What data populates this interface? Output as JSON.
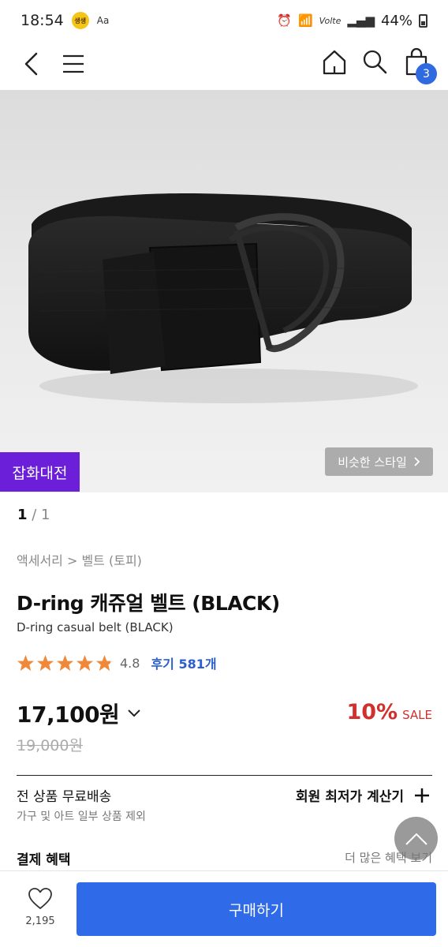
{
  "status_bar": {
    "time": "18:54",
    "emoji_text": "생생",
    "aa_text": "Aa",
    "wifi_text": "Volte",
    "battery": "44%"
  },
  "header": {
    "cart_count": "3"
  },
  "hero": {
    "promo_tag": "잡화대전",
    "similar_style": "비슷한 스타일"
  },
  "pager": {
    "current": "1",
    "total": "/ 1"
  },
  "product": {
    "breadcrumb": "액세서리 > 벨트 (토피)",
    "title": "D-ring 캐쥬얼 벨트 (BLACK)",
    "subtitle": "D-ring casual belt (BLACK)",
    "rating": 4.8,
    "rating_text": "4.8",
    "review_link": "후기 581개",
    "price": "17,100원",
    "original_price": "19,000원",
    "discount_pct": "10%",
    "discount_label": "SALE"
  },
  "shipping": {
    "title": "전 상품 무료배송",
    "note": "가구 및 아트 일부 상품 제외",
    "member_calc": "회원 최저가 계산기"
  },
  "payment": {
    "title": "결제 혜택",
    "more": "더 많은 혜택 보기"
  },
  "bottom": {
    "like_count": "2,195",
    "buy_label": "구매하기"
  },
  "colors": {
    "accent": "#2f6ae8",
    "promo": "#6b1fd8",
    "sale": "#d0312d",
    "star": "#f0883a"
  }
}
